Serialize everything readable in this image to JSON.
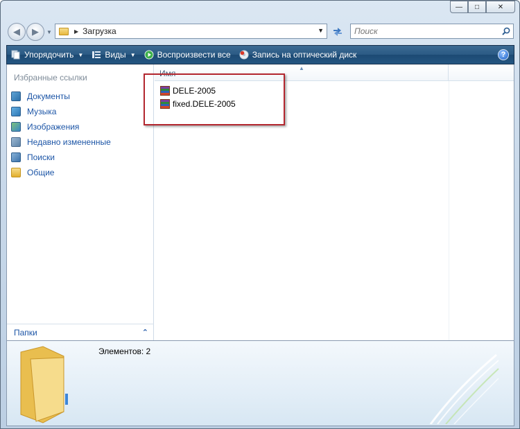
{
  "window": {
    "caption_min": "—",
    "caption_max": "□",
    "caption_close": "✕"
  },
  "address": {
    "path_label": "Загрузка",
    "search_placeholder": "Поиск"
  },
  "toolbar": {
    "organize_label": "Упорядочить",
    "views_label": "Виды",
    "play_label": "Воспроизвести все",
    "burn_label": "Запись на оптический диск",
    "help_label": "?"
  },
  "sidebar": {
    "title": "Избранные ссылки",
    "items": [
      {
        "label": "Документы",
        "icon": "documents-icon"
      },
      {
        "label": "Музыка",
        "icon": "music-icon"
      },
      {
        "label": "Изображения",
        "icon": "pictures-icon"
      },
      {
        "label": "Недавно измененные",
        "icon": "recent-icon"
      },
      {
        "label": "Поиски",
        "icon": "searches-icon"
      },
      {
        "label": "Общие",
        "icon": "public-folder-icon"
      }
    ],
    "folders_label": "Папки"
  },
  "filelist": {
    "column_name": "Имя",
    "files": [
      {
        "name": "DELE-2005",
        "icon": "rar-archive-icon"
      },
      {
        "name": "fixed.DELE-2005",
        "icon": "rar-archive-icon"
      }
    ]
  },
  "details": {
    "items_text": "Элементов: 2"
  },
  "colors": {
    "toolbar": "#2b5a84",
    "link": "#1c55a6",
    "highlight": "#b3262e"
  }
}
